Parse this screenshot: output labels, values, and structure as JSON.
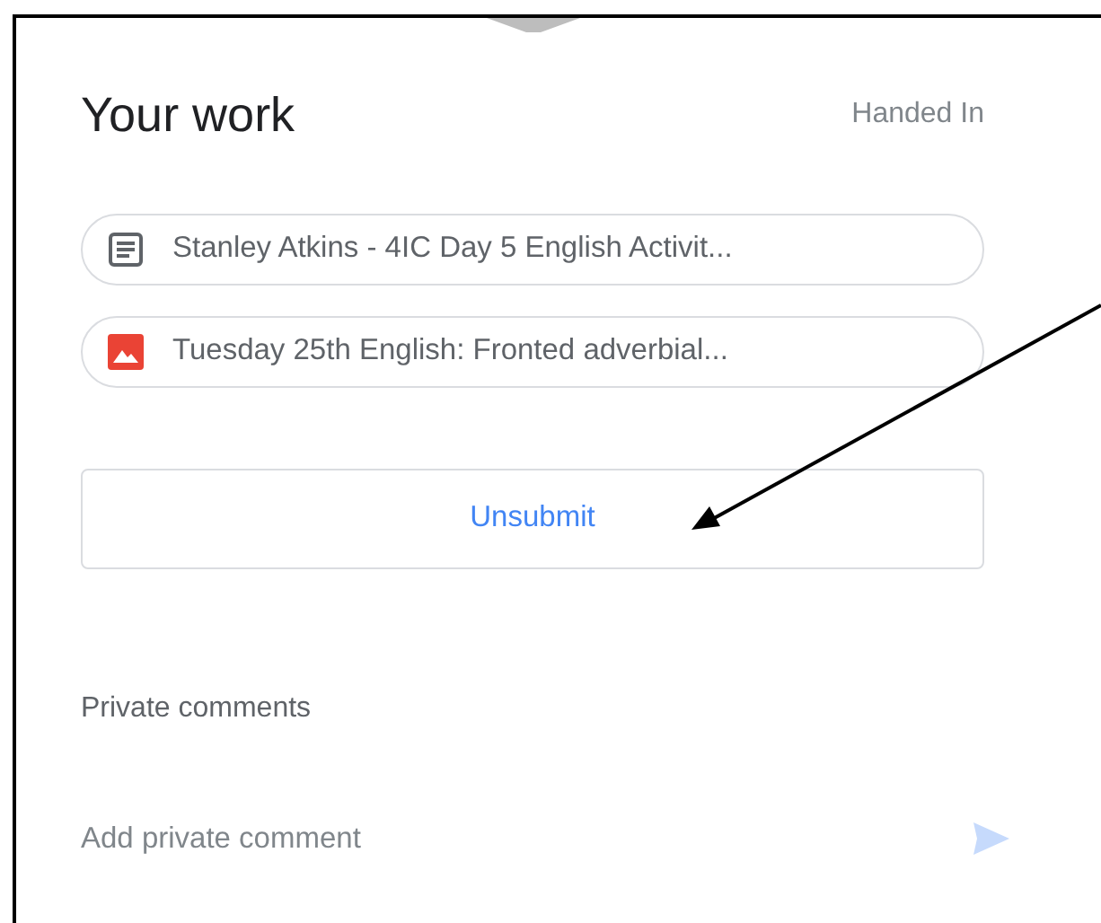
{
  "header": {
    "title": "Your work",
    "status": "Handed In"
  },
  "attachments": [
    {
      "kind": "document",
      "name": "Stanley Atkins - 4IC Day 5 English Activit..."
    },
    {
      "kind": "image",
      "name": "Tuesday 25th English: Fronted adverbial..."
    }
  ],
  "action_button": "Unsubmit",
  "comments": {
    "label": "Private comments",
    "placeholder": "Add private comment"
  }
}
